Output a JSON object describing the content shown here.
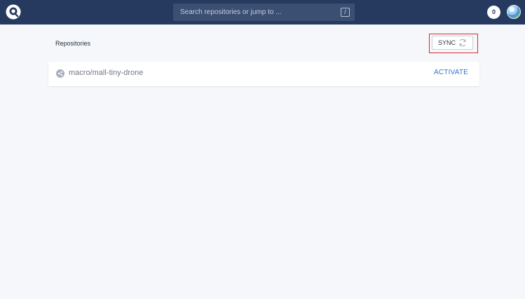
{
  "topbar": {
    "search_placeholder": "Search repositories or jump to ...",
    "search_shortcut": "/",
    "notification_count": "0"
  },
  "page": {
    "title": "Repositories",
    "sync_label": "SYNC"
  },
  "repositories": [
    {
      "name": "macro/mall-tiny-drone",
      "action_label": "ACTIVATE"
    }
  ],
  "colors": {
    "topbar": "#253a5e",
    "accent": "#2f75c7",
    "highlight": "#d62d2d"
  }
}
